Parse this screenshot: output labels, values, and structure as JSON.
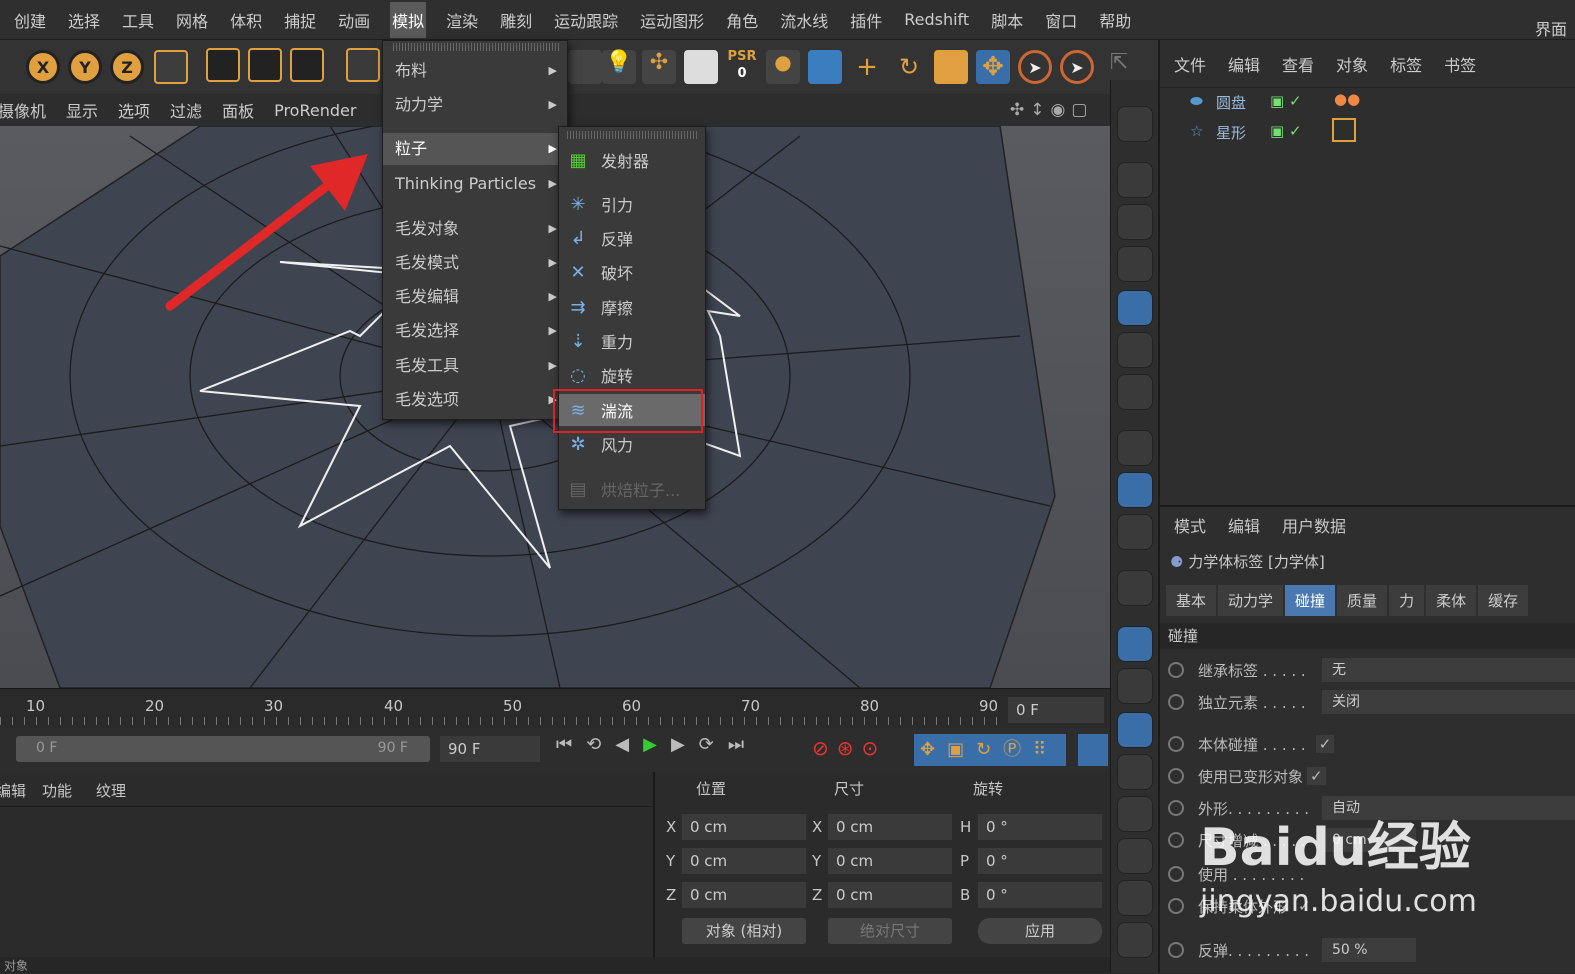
{
  "menubar": {
    "items": [
      "创建",
      "选择",
      "工具",
      "网格",
      "体积",
      "捕捉",
      "动画",
      "模拟",
      "渲染",
      "雕刻",
      "运动跟踪",
      "运动图形",
      "角色",
      "流水线",
      "插件",
      "Redshift",
      "脚本",
      "窗口",
      "帮助"
    ],
    "active_index": 7,
    "right_label": "界面"
  },
  "toolbar": {
    "axis_x": "X",
    "axis_y": "Y",
    "axis_z": "Z",
    "psr_label": "PSR",
    "psr_value": "0"
  },
  "viewport_menu": {
    "items": [
      "摄像机",
      "显示",
      "选项",
      "过滤",
      "面板",
      "ProRender"
    ]
  },
  "menu_simulate": {
    "items": [
      {
        "label": "布料",
        "submenu": true
      },
      {
        "label": "动力学",
        "submenu": true
      },
      {
        "label": "粒子",
        "submenu": true,
        "highlighted": true
      },
      {
        "label": "Thinking Particles",
        "submenu": true
      },
      {
        "label": "毛发对象",
        "submenu": true
      },
      {
        "label": "毛发模式",
        "submenu": true
      },
      {
        "label": "毛发编辑",
        "submenu": true
      },
      {
        "label": "毛发选择",
        "submenu": true
      },
      {
        "label": "毛发工具",
        "submenu": true
      },
      {
        "label": "毛发选项",
        "submenu": true
      }
    ]
  },
  "menu_particles": {
    "items": [
      {
        "label": "发射器",
        "icon": "emitter-icon"
      },
      {
        "label": "引力",
        "icon": "attractor-icon"
      },
      {
        "label": "反弹",
        "icon": "deflector-icon"
      },
      {
        "label": "破坏",
        "icon": "destructor-icon"
      },
      {
        "label": "摩擦",
        "icon": "friction-icon"
      },
      {
        "label": "重力",
        "icon": "gravity-icon"
      },
      {
        "label": "旋转",
        "icon": "rotation-icon"
      },
      {
        "label": "湍流",
        "icon": "turbulence-icon",
        "selected": true
      },
      {
        "label": "风力",
        "icon": "wind-icon"
      },
      {
        "label": "烘焙粒子...",
        "icon": "bake-particles-icon",
        "disabled": true
      }
    ]
  },
  "timeline": {
    "ticks": [
      "10",
      "20",
      "30",
      "40",
      "50",
      "60",
      "70",
      "80",
      "90"
    ],
    "current_frame": "0 F"
  },
  "playbar": {
    "range_start": "0 F",
    "range_end": "90 F",
    "end_frame": "90 F"
  },
  "material_menu": {
    "items": [
      "编辑",
      "功能",
      "纹理"
    ]
  },
  "coords": {
    "headers": [
      "位置",
      "尺寸",
      "旋转"
    ],
    "pos": {
      "x": "0 cm",
      "y": "0 cm",
      "z": "0 cm"
    },
    "size": {
      "x": "0 cm",
      "y": "0 cm",
      "z": "0 cm"
    },
    "rot": {
      "h": "0 °",
      "p": "0 °",
      "b": "0 °"
    },
    "labels": {
      "x": "X",
      "y": "Y",
      "z": "Z",
      "h": "H",
      "p": "P",
      "b": "B"
    },
    "mode_select": "对象 (相对)",
    "size_select": "绝对尺寸",
    "apply_label": "应用"
  },
  "status_text": "对象",
  "object_manager": {
    "menu": [
      "文件",
      "编辑",
      "查看",
      "对象",
      "标签",
      "书签"
    ],
    "objects": [
      {
        "name": "圆盘",
        "icon": "disc-icon"
      },
      {
        "name": "星形",
        "icon": "star-icon"
      }
    ]
  },
  "attributes": {
    "menu": [
      "模式",
      "编辑",
      "用户数据"
    ],
    "title": "力学体标签 [力学体]",
    "tabs": [
      "基本",
      "动力学",
      "碰撞",
      "质量",
      "力",
      "柔体",
      "缓存"
    ],
    "active_tab": 2,
    "section": "碰撞",
    "rows": [
      {
        "label": "继承标签 . . . . .",
        "value": "无"
      },
      {
        "label": "独立元素 . . . . .",
        "value": "关闭"
      },
      {
        "label": "本体碰撞 . . . . .",
        "value": "✓"
      },
      {
        "label": "使用已变形对象",
        "value": "✓"
      },
      {
        "label": "外形. . . . . . . . .",
        "value": "自动"
      },
      {
        "label": "尺寸增减 . . . . .",
        "value": "0 cm"
      },
      {
        "label": "使用 . . . . . . . .",
        "value": ""
      },
      {
        "label": "保持柔体外形",
        "value": "✓"
      },
      {
        "label": "反弹. . . . . . . . .",
        "value": "50 %"
      }
    ]
  },
  "watermark": {
    "brand": "Bai",
    "paw": "du",
    "cn": "经验",
    "url": "jingyan.baidu.com"
  },
  "colors": {
    "accent": "#4a78b0",
    "highlight_box": "#dd2222",
    "arrow": "#e02828"
  }
}
